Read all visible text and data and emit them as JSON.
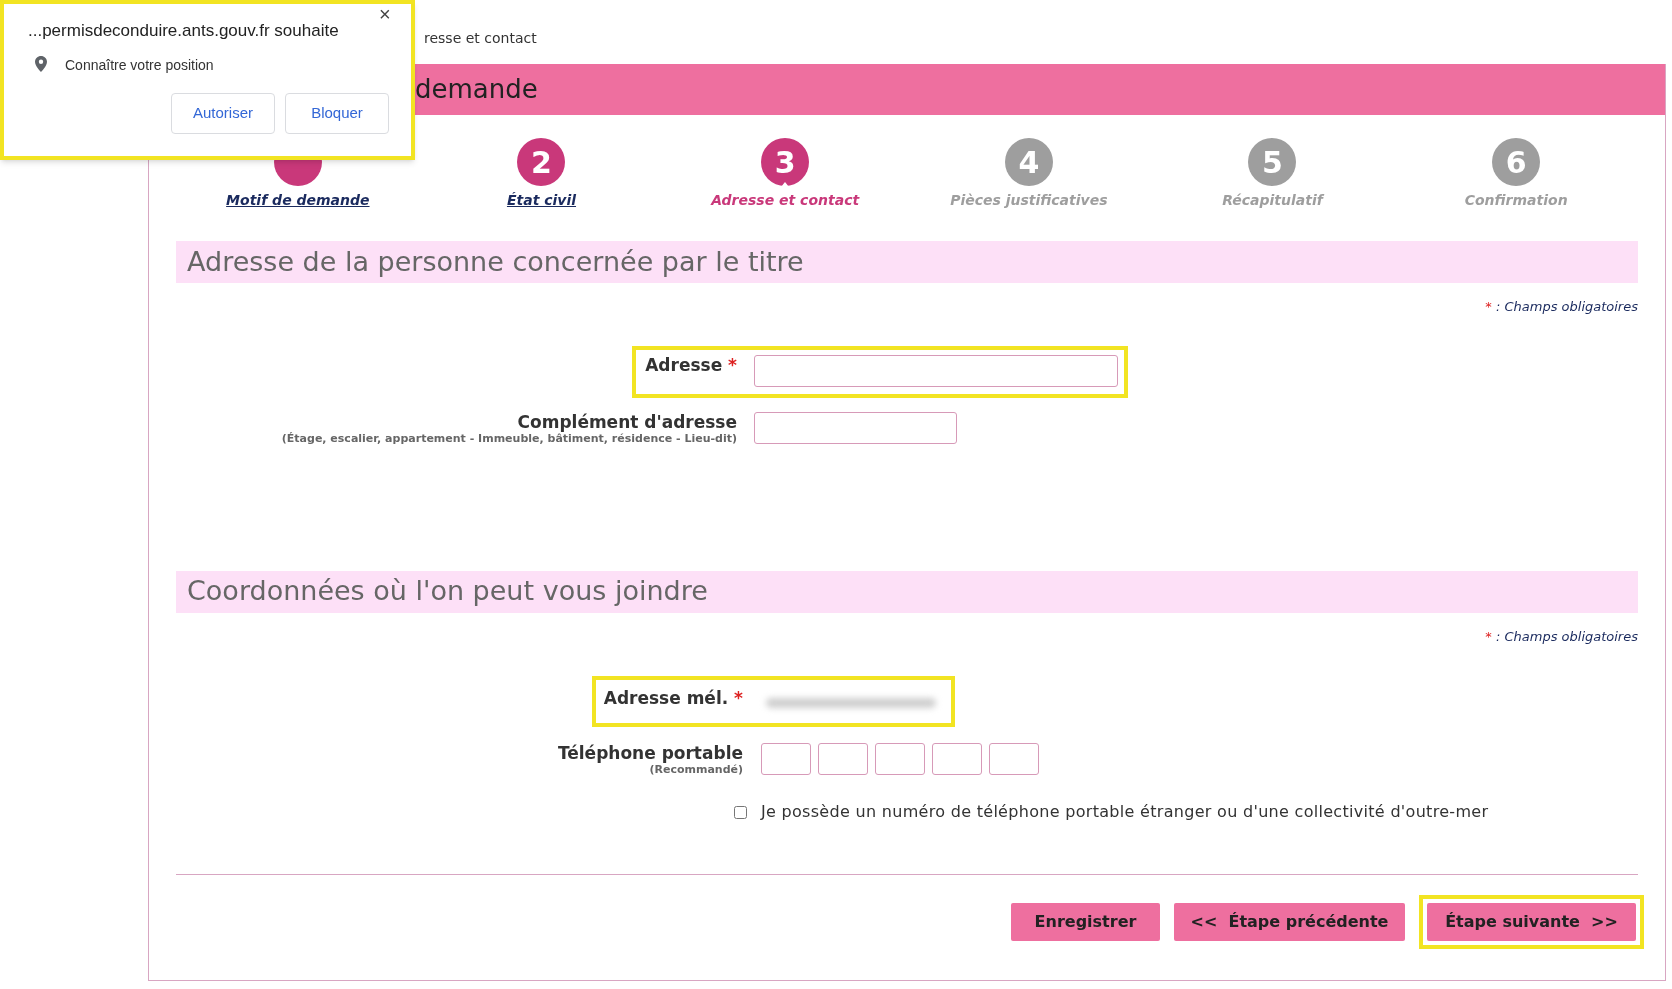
{
  "permission_popup": {
    "origin": "...permisdeconduire.ants.gouv.fr souhaite",
    "close": "×",
    "request": "Connaître votre position",
    "buttons": [
      "Autoriser",
      "Bloquer"
    ],
    "highlighted": true
  },
  "breadcrumb": "resse et contact",
  "header": {
    "title": "demande"
  },
  "steps": [
    {
      "label": "Motif de demande",
      "completed": true,
      "selected": false
    },
    {
      "number": "2",
      "label": "État civil",
      "completed": true,
      "selected": false
    },
    {
      "number": "3",
      "label": "Adresse et contact",
      "completed": false,
      "selected": true
    },
    {
      "number": "4",
      "label": "Pièces justificatives",
      "completed": false,
      "selected": false
    },
    {
      "number": "5",
      "label": "Récapitulatif",
      "completed": false,
      "selected": false
    },
    {
      "number": "6",
      "label": "Confirmation",
      "completed": false,
      "selected": false
    }
  ],
  "sections": [
    {
      "title": "Adresse de la personne concernée par le titre",
      "required_mark": "*",
      "required_note": ": Champs obligatoires",
      "fields": [
        {
          "kind": "long_text",
          "label": "Adresse",
          "required": true,
          "highlighted": true
        },
        {
          "kind": "short_text",
          "label": "Complément d'adresse",
          "hint": "(Étage, escalier, appartement - Immeuble, bâtiment, résidence - Lieu-dit)",
          "required": false,
          "highlighted": false
        }
      ]
    },
    {
      "title": "Coordonnées où l'on peut vous joindre",
      "required_mark": "*",
      "required_note": ": Champs obligatoires",
      "fields": [
        {
          "kind": "blurred_email",
          "label": "Adresse mél.",
          "required": true,
          "highlighted": true
        },
        {
          "kind": "phone",
          "label": "Téléphone portable",
          "hint": "(Recommandé)",
          "required": false
        },
        {
          "kind": "checkbox",
          "label": "Je possède un numéro de téléphone portable étranger ou d'une collectivité d'outre-mer",
          "checked": false
        }
      ]
    }
  ],
  "buttons": [
    {
      "label": "Enregistrer",
      "highlighted": false
    },
    {
      "label": "<<  Étape précédente",
      "highlighted": false
    },
    {
      "label": "Étape suivante  >>",
      "highlighted": true
    }
  ]
}
